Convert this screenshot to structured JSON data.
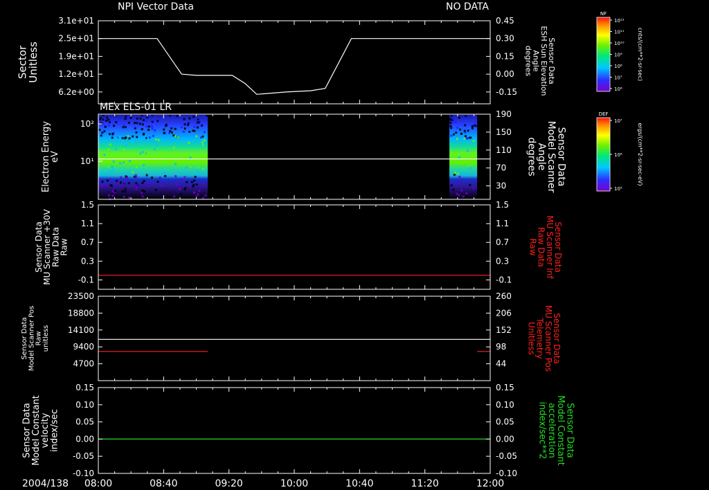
{
  "time_axis": {
    "date_label": "2004/138",
    "ticks": [
      "08:00",
      "08:40",
      "09:20",
      "10:00",
      "10:40",
      "11:20",
      "12:00"
    ]
  },
  "colors": {
    "background": "#000000",
    "frame": "#ffffff",
    "red": "#ff2020",
    "green": "#22dd22"
  },
  "chart_data": [
    {
      "type": "line",
      "panel_title": "NPI Vector Data",
      "status": "NO DATA",
      "left_axis": {
        "label_lines": [
          "Sector",
          "Unitless"
        ],
        "ticks": [
          "3.1e+01",
          "2.5e+01",
          "1.9e+01",
          "1.2e+01",
          "6.2e+00"
        ]
      },
      "right_axis": {
        "label_lines": [
          "Sensor Data",
          "ESH Sun Elevation",
          "Angle",
          "degrees"
        ],
        "ticks": [
          "0.45",
          "0.30",
          "0.15",
          "0.00",
          "-0.15"
        ],
        "ylim": [
          -0.25,
          0.45
        ]
      },
      "series": [
        {
          "color": "#ffffff",
          "x": [
            "08:00",
            "08:36",
            "08:51",
            "09:00",
            "09:08",
            "09:14",
            "09:22",
            "09:30",
            "09:37",
            "09:55",
            "10:10",
            "10:19",
            "10:35",
            "10:40",
            "12:00"
          ],
          "y": [
            0.3,
            0.3,
            0.0,
            -0.01,
            -0.01,
            -0.01,
            -0.01,
            -0.08,
            -0.17,
            -0.15,
            -0.14,
            -0.12,
            0.3,
            0.3,
            0.3
          ]
        }
      ]
    },
    {
      "type": "heatmap",
      "panel_title": "MEx ELS-01 LR",
      "left_axis": {
        "label_lines": [
          "Electron Energy",
          "eV"
        ],
        "scale": "log",
        "ticks": [
          "10²",
          "10¹"
        ]
      },
      "right_axis": {
        "label_lines": [
          "Sensor Data",
          "Model Scanner",
          "Angle",
          "degrees"
        ],
        "ticks": [
          "190",
          "150",
          "110",
          "70",
          "30"
        ],
        "ylim": [
          0,
          190
        ]
      },
      "data_intervals": [
        [
          "08:00",
          "09:07"
        ],
        [
          "11:35",
          "11:52"
        ]
      ],
      "energy_bands": [
        {
          "energy_eV_range": [
            50,
            200
          ],
          "level": "blue"
        },
        {
          "energy_eV_range": [
            20,
            50
          ],
          "level": "cyan"
        },
        {
          "energy_eV_range": [
            7,
            20
          ],
          "level": "green"
        },
        {
          "energy_eV_range": [
            4,
            7
          ],
          "level": "cyan"
        },
        {
          "energy_eV_range": [
            1,
            4
          ],
          "level": "purple"
        }
      ],
      "series": [
        {
          "color": "#ffffff",
          "x": [
            "08:00",
            "12:00"
          ],
          "y": [
            90,
            90
          ]
        }
      ]
    },
    {
      "type": "line",
      "left_axis": {
        "label_lines": [
          "Sensor Data",
          "MU Scanner +30V",
          "Raw Data",
          "Raw"
        ],
        "ticks": [
          "1.5",
          "1.1",
          "0.7",
          "0.3",
          "-0.1"
        ],
        "ylim": [
          -0.3,
          1.5
        ]
      },
      "right_axis": {
        "label_lines": [
          "Sensor Data",
          "MU Scanner Inf",
          "Raw Data",
          "Raw"
        ],
        "ticks": [
          "1.5",
          "1.1",
          "0.7",
          "0.3",
          "-0.1"
        ],
        "color": "#ff2020"
      },
      "series": [
        {
          "color": "#ff2020",
          "x": [
            "08:00",
            "12:00"
          ],
          "y": [
            0.0,
            0.0
          ]
        }
      ]
    },
    {
      "type": "line",
      "left_axis": {
        "label_lines": [
          "Sensor Data",
          "Model Scanner Pos",
          "Raw",
          "unitless"
        ],
        "ticks": [
          "23500",
          "18800",
          "14100",
          "9400",
          "4700"
        ],
        "ylim": [
          0,
          23500
        ]
      },
      "right_axis": {
        "label_lines": [
          "Sensor Data",
          "MU Scanner Pos",
          "Telemetry",
          "Unitless"
        ],
        "ticks": [
          "260",
          "206",
          "152",
          "98",
          "44"
        ],
        "ylim": [
          0,
          260
        ],
        "color": "#ff2020"
      },
      "series": [
        {
          "axis": "left",
          "color": "#ffffff",
          "x": [
            "08:00",
            "12:00"
          ],
          "y": [
            11500,
            11500
          ]
        },
        {
          "axis": "right",
          "color": "#ff2020",
          "x": [
            "08:00",
            "09:07"
          ],
          "y": [
            90,
            90
          ]
        },
        {
          "axis": "right",
          "color": "#ff2020",
          "x": [
            "11:52",
            "12:00"
          ],
          "y": [
            90,
            90
          ]
        }
      ]
    },
    {
      "type": "line",
      "left_axis": {
        "label_lines": [
          "Sensor Data",
          "Model Constant",
          "velocity",
          "index/sec"
        ],
        "ticks": [
          "0.15",
          "0.10",
          "0.05",
          "0.00",
          "-0.05",
          "-0.10"
        ],
        "ylim": [
          -0.1,
          0.15
        ]
      },
      "right_axis": {
        "label_lines": [
          "Sensor Data",
          "Model Constant",
          "acceleration",
          "index/sec**2"
        ],
        "ticks": [
          "0.15",
          "0.10",
          "0.05",
          "0.00",
          "-0.05",
          "-0.10"
        ],
        "color": "#22dd22"
      },
      "series": [
        {
          "color": "#22dd22",
          "x": [
            "08:00",
            "12:00"
          ],
          "y": [
            0.0,
            0.0
          ]
        }
      ]
    }
  ],
  "colorbars": [
    {
      "tag": "NF",
      "ticks": [
        "10¹²",
        "10¹¹",
        "10¹⁰",
        "10⁹",
        "10⁸",
        "10⁷",
        "10⁶"
      ],
      "unit": "cnts/(cm**2-sr-sec)"
    },
    {
      "tag": "DEF",
      "ticks": [
        "10⁷",
        "10⁶",
        "10⁵"
      ],
      "unit": "ergs/(cm**2-sr-sec-eV)"
    }
  ]
}
